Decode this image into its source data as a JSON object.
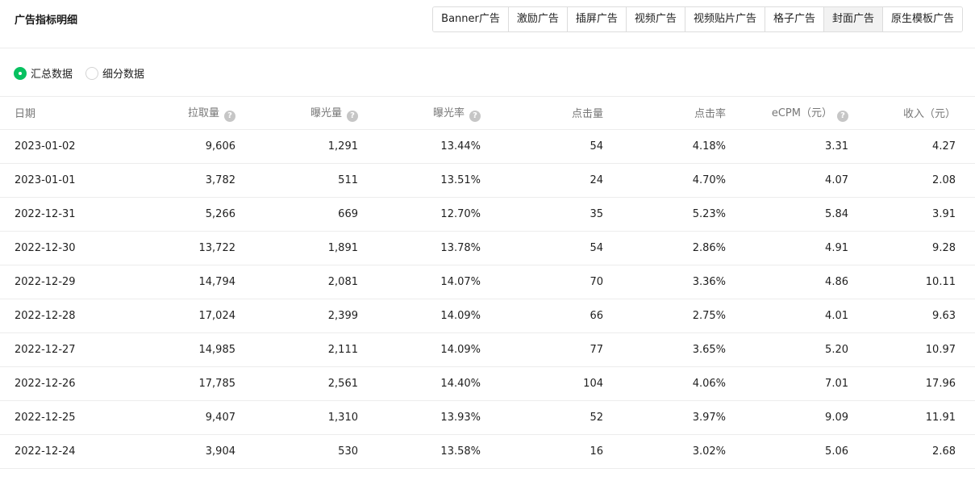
{
  "header": {
    "title": "广告指标明细",
    "tabs": [
      {
        "label": "Banner广告",
        "active": false
      },
      {
        "label": "激励广告",
        "active": false
      },
      {
        "label": "插屏广告",
        "active": false
      },
      {
        "label": "视频广告",
        "active": false
      },
      {
        "label": "视频贴片广告",
        "active": false
      },
      {
        "label": "格子广告",
        "active": false
      },
      {
        "label": "封面广告",
        "active": true
      },
      {
        "label": "原生模板广告",
        "active": false
      }
    ]
  },
  "filters": {
    "options": [
      {
        "label": "汇总数据",
        "checked": true
      },
      {
        "label": "细分数据",
        "checked": false
      }
    ]
  },
  "table": {
    "columns": [
      {
        "label": "日期",
        "help": false
      },
      {
        "label": "拉取量",
        "help": true
      },
      {
        "label": "曝光量",
        "help": true
      },
      {
        "label": "曝光率",
        "help": true
      },
      {
        "label": "点击量",
        "help": false
      },
      {
        "label": "点击率",
        "help": false
      },
      {
        "label": "eCPM（元）",
        "help": true
      },
      {
        "label": "收入（元）",
        "help": false
      }
    ],
    "rows": [
      [
        "2023-01-02",
        "9,606",
        "1,291",
        "13.44%",
        "54",
        "4.18%",
        "3.31",
        "4.27"
      ],
      [
        "2023-01-01",
        "3,782",
        "511",
        "13.51%",
        "24",
        "4.70%",
        "4.07",
        "2.08"
      ],
      [
        "2022-12-31",
        "5,266",
        "669",
        "12.70%",
        "35",
        "5.23%",
        "5.84",
        "3.91"
      ],
      [
        "2022-12-30",
        "13,722",
        "1,891",
        "13.78%",
        "54",
        "2.86%",
        "4.91",
        "9.28"
      ],
      [
        "2022-12-29",
        "14,794",
        "2,081",
        "14.07%",
        "70",
        "3.36%",
        "4.86",
        "10.11"
      ],
      [
        "2022-12-28",
        "17,024",
        "2,399",
        "14.09%",
        "66",
        "2.75%",
        "4.01",
        "9.63"
      ],
      [
        "2022-12-27",
        "14,985",
        "2,111",
        "14.09%",
        "77",
        "3.65%",
        "5.20",
        "10.97"
      ],
      [
        "2022-12-26",
        "17,785",
        "2,561",
        "14.40%",
        "104",
        "4.06%",
        "7.01",
        "17.96"
      ],
      [
        "2022-12-25",
        "9,407",
        "1,310",
        "13.93%",
        "52",
        "3.97%",
        "9.09",
        "11.91"
      ],
      [
        "2022-12-24",
        "3,904",
        "530",
        "13.58%",
        "16",
        "3.02%",
        "5.06",
        "2.68"
      ]
    ]
  },
  "colors": {
    "accent": "#07c160",
    "help_icon": "#c6c6c6",
    "active_tab_bg": "#f2f2f2"
  },
  "icons": {
    "help": "question-circle-icon"
  }
}
